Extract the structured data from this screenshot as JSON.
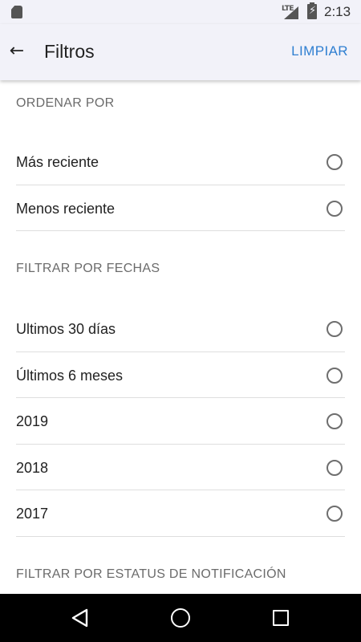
{
  "status_bar": {
    "network": "LTE",
    "time": "2:13",
    "battery_bolt": "⚡"
  },
  "app_bar": {
    "back_glyph": "←",
    "title": "Filtros",
    "clear_label": "LIMPIAR"
  },
  "sections": {
    "sort": {
      "header": "ORDENAR POR",
      "options": [
        "Más reciente",
        "Menos reciente"
      ]
    },
    "dates": {
      "header": "FILTRAR POR FECHAS",
      "options": [
        "Ultimos 30 días",
        "Últimos 6 meses",
        "2019",
        "2018",
        "2017"
      ]
    },
    "notification": {
      "header": "FILTRAR POR ESTATUS DE NOTIFICACIÓN"
    }
  },
  "colors": {
    "accent": "#2f7fd1",
    "bar_background": "#f2f2f9",
    "nav_background": "#000000"
  }
}
